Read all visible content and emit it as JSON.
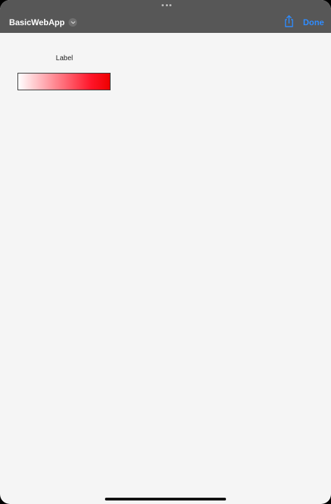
{
  "header": {
    "app_title": "BasicWebApp",
    "done_label": "Done",
    "icons": {
      "grabber": "more-dots-icon",
      "switcher": "chevron-down-icon",
      "share": "share-icon"
    }
  },
  "content": {
    "label": "Label",
    "progress": {
      "value": 1.0,
      "fill_start_color": "#ffffff",
      "fill_end_color": "#ee0000"
    }
  },
  "colors": {
    "toolbar_background": "#575757",
    "page_background": "#f5f5f5",
    "accent": "#2f8cff"
  }
}
